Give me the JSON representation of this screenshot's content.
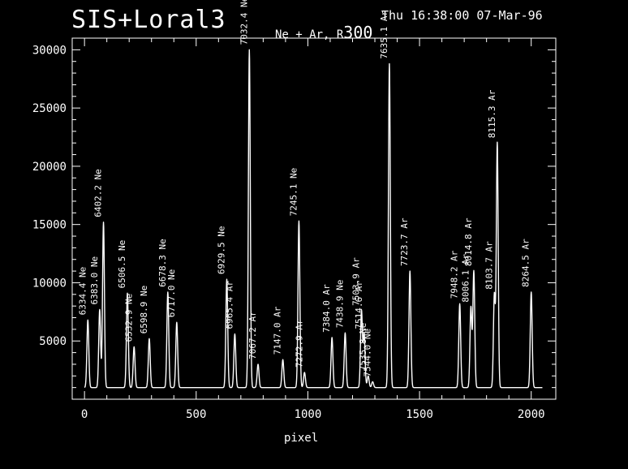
{
  "header": {
    "title": "SIS+Loral3",
    "timestamp": "Thu 16:38:00 07-Mar-96",
    "subtitle_prefix": "Ne + Ar, R",
    "subtitle_suffix": "300"
  },
  "chart_data": {
    "type": "line",
    "title": "Ne + Ar, R300",
    "xlabel": "pixel",
    "ylabel": "",
    "xlim": [
      -55,
      2110
    ],
    "ylim": [
      0,
      31000
    ],
    "xticks": [
      0,
      500,
      1000,
      1500,
      2000
    ],
    "yticks": [
      5000,
      10000,
      15000,
      20000,
      25000,
      30000
    ],
    "baseline": 1000,
    "colors": {
      "background": "#000000",
      "foreground": "#ffffff"
    },
    "peaks": [
      {
        "x": 15,
        "y": 6800,
        "label": "6334.4 Ne"
      },
      {
        "x": 68,
        "y": 7700,
        "label": "6383.0 Ne"
      },
      {
        "x": 85,
        "y": 15200,
        "label": "6402.2 Ne"
      },
      {
        "x": 192,
        "y": 9100,
        "label": "6506.5 Ne"
      },
      {
        "x": 222,
        "y": 4500,
        "label": "6532.9 Ne"
      },
      {
        "x": 290,
        "y": 5200,
        "label": "6598.9 Ne"
      },
      {
        "x": 373,
        "y": 9200,
        "label": "6678.3 Ne"
      },
      {
        "x": 413,
        "y": 6600,
        "label": "6717.0 Ne"
      },
      {
        "x": 637,
        "y": 10300,
        "label": "6929.5 Ne"
      },
      {
        "x": 673,
        "y": 5600,
        "label": "6965.4 Ar"
      },
      {
        "x": 738,
        "y": 30000,
        "label": "7032.4 Ne"
      },
      {
        "x": 777,
        "y": 3000,
        "label": "7067.2 Ar"
      },
      {
        "x": 888,
        "y": 3400,
        "label": "7147.0 Ar"
      },
      {
        "x": 960,
        "y": 15300,
        "label": "7245.1 Ne"
      },
      {
        "x": 985,
        "y": 2300,
        "label": "7272.9 Ar"
      },
      {
        "x": 1108,
        "y": 5300,
        "label": "7384.0 Ar"
      },
      {
        "x": 1167,
        "y": 5700,
        "label": "7438.9 Ne"
      },
      {
        "x": 1240,
        "y": 7600,
        "label": "7503.9 Ar"
      },
      {
        "x": 1252,
        "y": 5600,
        "label": "7514.6 Ar"
      },
      {
        "x": 1270,
        "y": 2000,
        "label": "7535.8 Ne"
      },
      {
        "x": 1290,
        "y": 1500,
        "label": "7544.0 Ne"
      },
      {
        "x": 1365,
        "y": 28800,
        "label": "7635.1 Ar"
      },
      {
        "x": 1457,
        "y": 11000,
        "label": "7723.7 Ar"
      },
      {
        "x": 1680,
        "y": 8200,
        "label": "7948.2 Ar"
      },
      {
        "x": 1730,
        "y": 7900,
        "label": "8006.1 Ar"
      },
      {
        "x": 1743,
        "y": 11000,
        "label": "8014.8 Ar"
      },
      {
        "x": 1835,
        "y": 9000,
        "label": "8103.7 Ar"
      },
      {
        "x": 1848,
        "y": 22000,
        "label": "8115.3 Ar"
      },
      {
        "x": 2000,
        "y": 9200,
        "label": "8264.5 Ar"
      }
    ]
  }
}
